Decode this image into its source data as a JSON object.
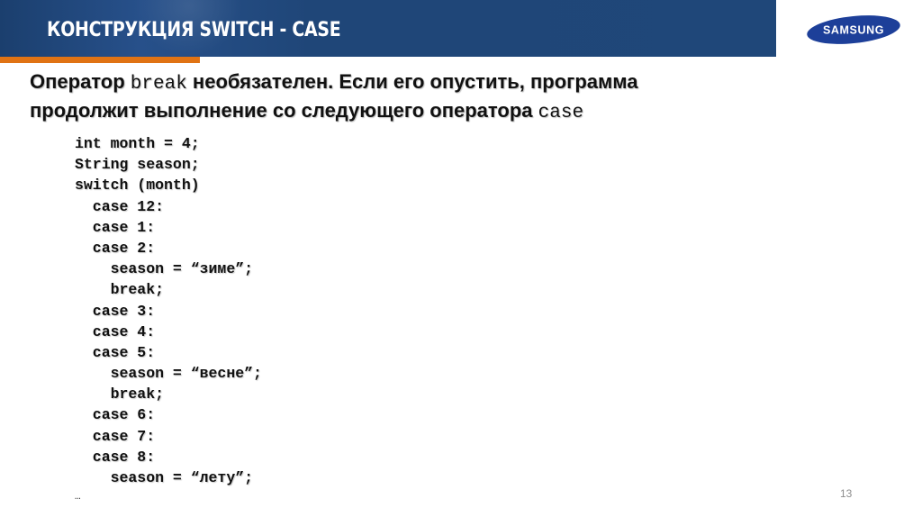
{
  "header": {
    "title": "КОНСТРУКЦИЯ SWITCH - CASE",
    "logo_text": "SAMSUNG",
    "colors": {
      "band": "#1f4779",
      "accent": "#e07314",
      "logo_blue": "#1d3f99"
    }
  },
  "intro": {
    "part1": "Оператор ",
    "code1": "break",
    "part2": " необязателен. Если его опустить, программа",
    "part3": "продолжит выполнение со следующего оператора ",
    "code2": "case"
  },
  "code": [
    "int month = 4;",
    "String season;",
    "switch (month)",
    "  case 12:",
    "  case 1:",
    "  case 2:",
    "    season = “зиме”;",
    "    break;",
    "  case 3:",
    "  case 4:",
    "  case 5:",
    "    season = “весне”;",
    "    break;",
    "  case 6:",
    "  case 7:",
    "  case 8:",
    "    season = “лету”;"
  ],
  "ellipsis": "…",
  "page_number": "13"
}
